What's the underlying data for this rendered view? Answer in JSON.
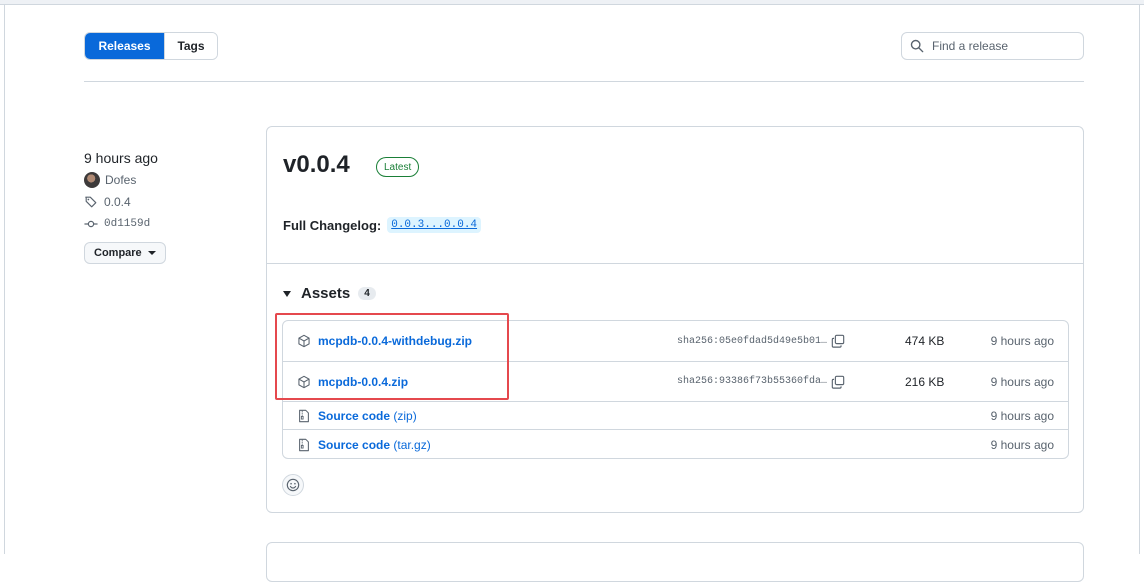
{
  "tabs": [
    {
      "label": "Releases",
      "active": true
    },
    {
      "label": "Tags",
      "active": false
    }
  ],
  "search": {
    "placeholder": "Find a release",
    "value": ""
  },
  "sidebar": {
    "time": "9 hours ago",
    "author": "Dofes",
    "tag": "0.0.4",
    "commit": "0d1159d",
    "compare_label": "Compare"
  },
  "release": {
    "title": "v0.0.4",
    "badge": "Latest",
    "changelog_label": "Full Changelog:",
    "changelog_range": "0.0.3...0.0.4",
    "assets_label": "Assets",
    "assets_count": "4",
    "assets": [
      {
        "name": "mcpdb-0.0.4-withdebug.zip",
        "sha": "sha256:05e0fdad5d49e5b01…",
        "size": "474 KB",
        "time": "9 hours ago",
        "icon": "package-icon"
      },
      {
        "name": "mcpdb-0.0.4.zip",
        "sha": "sha256:93386f73b55360fda…",
        "size": "216 KB",
        "time": "9 hours ago",
        "icon": "package-icon"
      },
      {
        "name": "Source code",
        "sub": "(zip)",
        "time": "9 hours ago",
        "icon": "file-zip-icon"
      },
      {
        "name": "Source code",
        "sub": "(tar.gz)",
        "time": "9 hours ago",
        "icon": "file-zip-icon"
      }
    ]
  },
  "colors": {
    "accent": "#0969da",
    "latest": "#1a7f37",
    "highlight": "#e5484d"
  }
}
